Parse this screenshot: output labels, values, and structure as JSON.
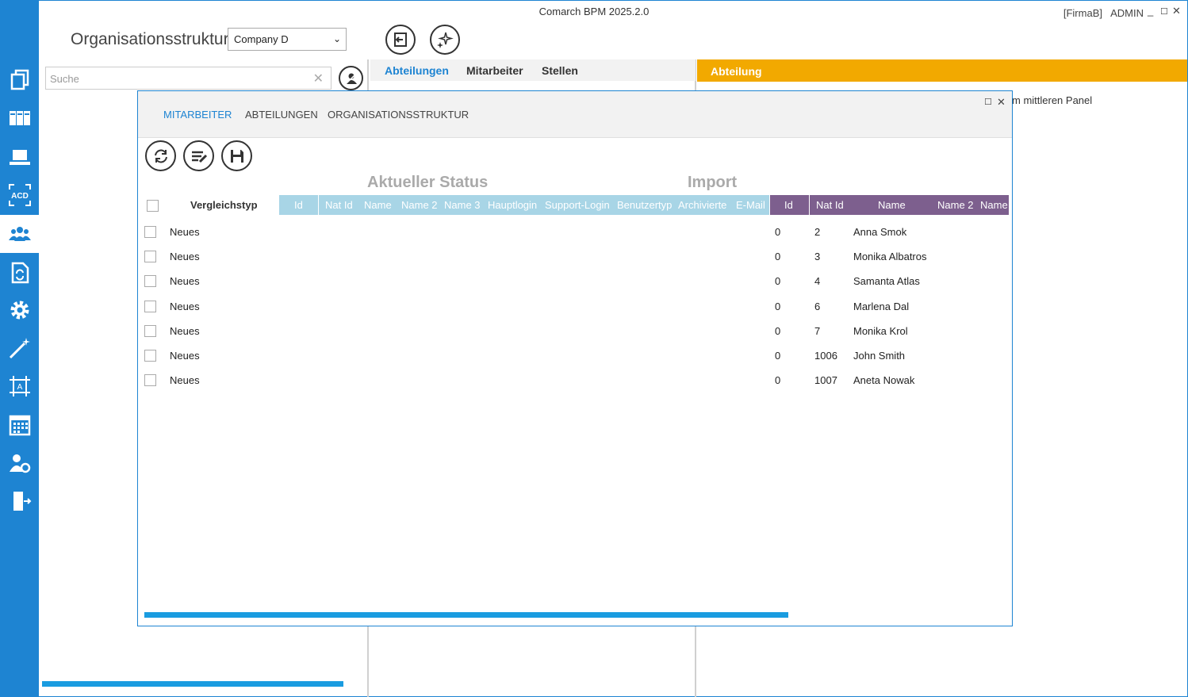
{
  "window": {
    "title": "Comarch BPM 2025.2.0",
    "company_tag": "[FirmaB]",
    "user": "ADMIN",
    "minimize": "_",
    "maximize": "☐",
    "close": "✕"
  },
  "header": {
    "page_title": "Organisationsstruktur",
    "company_select": "Company D"
  },
  "search": {
    "placeholder": "Suche",
    "clear": "✕"
  },
  "middle_tabs": [
    "Abteilungen",
    "Mitarbeiter",
    "Stellen"
  ],
  "right_panel": {
    "title": "Abteilung",
    "hint": "m mittleren Panel"
  },
  "dialog": {
    "tabs": [
      "MITARBEITER",
      "ABTEILUNGEN",
      "ORGANISATIONSSTRUKTUR"
    ],
    "maximize": "☐",
    "close": "✕",
    "section_current": "Aktueller Status",
    "section_import": "Import",
    "compare_header": "Vergleichstyp",
    "current_columns": [
      "Id",
      "Nat Id",
      "Name",
      "Name 2",
      "Name 3",
      "Hauptlogin",
      "Support-Login",
      "Benutzertyp",
      "Archivierte",
      "E-Mail"
    ],
    "import_columns": [
      "Id",
      "Nat Id",
      "Name",
      "Name 2",
      "Name"
    ],
    "rows": [
      {
        "type": "Neues",
        "id": "0",
        "nat_id": "2",
        "name": "Anna Smok"
      },
      {
        "type": "Neues",
        "id": "0",
        "nat_id": "3",
        "name": "Monika Albatros"
      },
      {
        "type": "Neues",
        "id": "0",
        "nat_id": "4",
        "name": "Samanta Atlas"
      },
      {
        "type": "Neues",
        "id": "0",
        "nat_id": "6",
        "name": "Marlena Dal"
      },
      {
        "type": "Neues",
        "id": "0",
        "nat_id": "7",
        "name": "Monika Krol"
      },
      {
        "type": "Neues",
        "id": "0",
        "nat_id": "1006",
        "name": "John Smith"
      },
      {
        "type": "Neues",
        "id": "0",
        "nat_id": "1007",
        "name": "Aneta Nowak"
      }
    ]
  },
  "sidebar_icons": [
    "documents-icon",
    "boards-icon",
    "laptop-icon",
    "acd-icon",
    "users-icon",
    "document-refresh-icon",
    "gear-icon",
    "magic-wand-icon",
    "design-icon",
    "calendar-icon",
    "user-settings-icon",
    "exit-icon"
  ],
  "colors": {
    "accent": "#1e84d2",
    "orange": "#f2a900",
    "current_header": "#a8d5e6",
    "import_header": "#7d5f8e",
    "progress": "#1a9ce0"
  }
}
